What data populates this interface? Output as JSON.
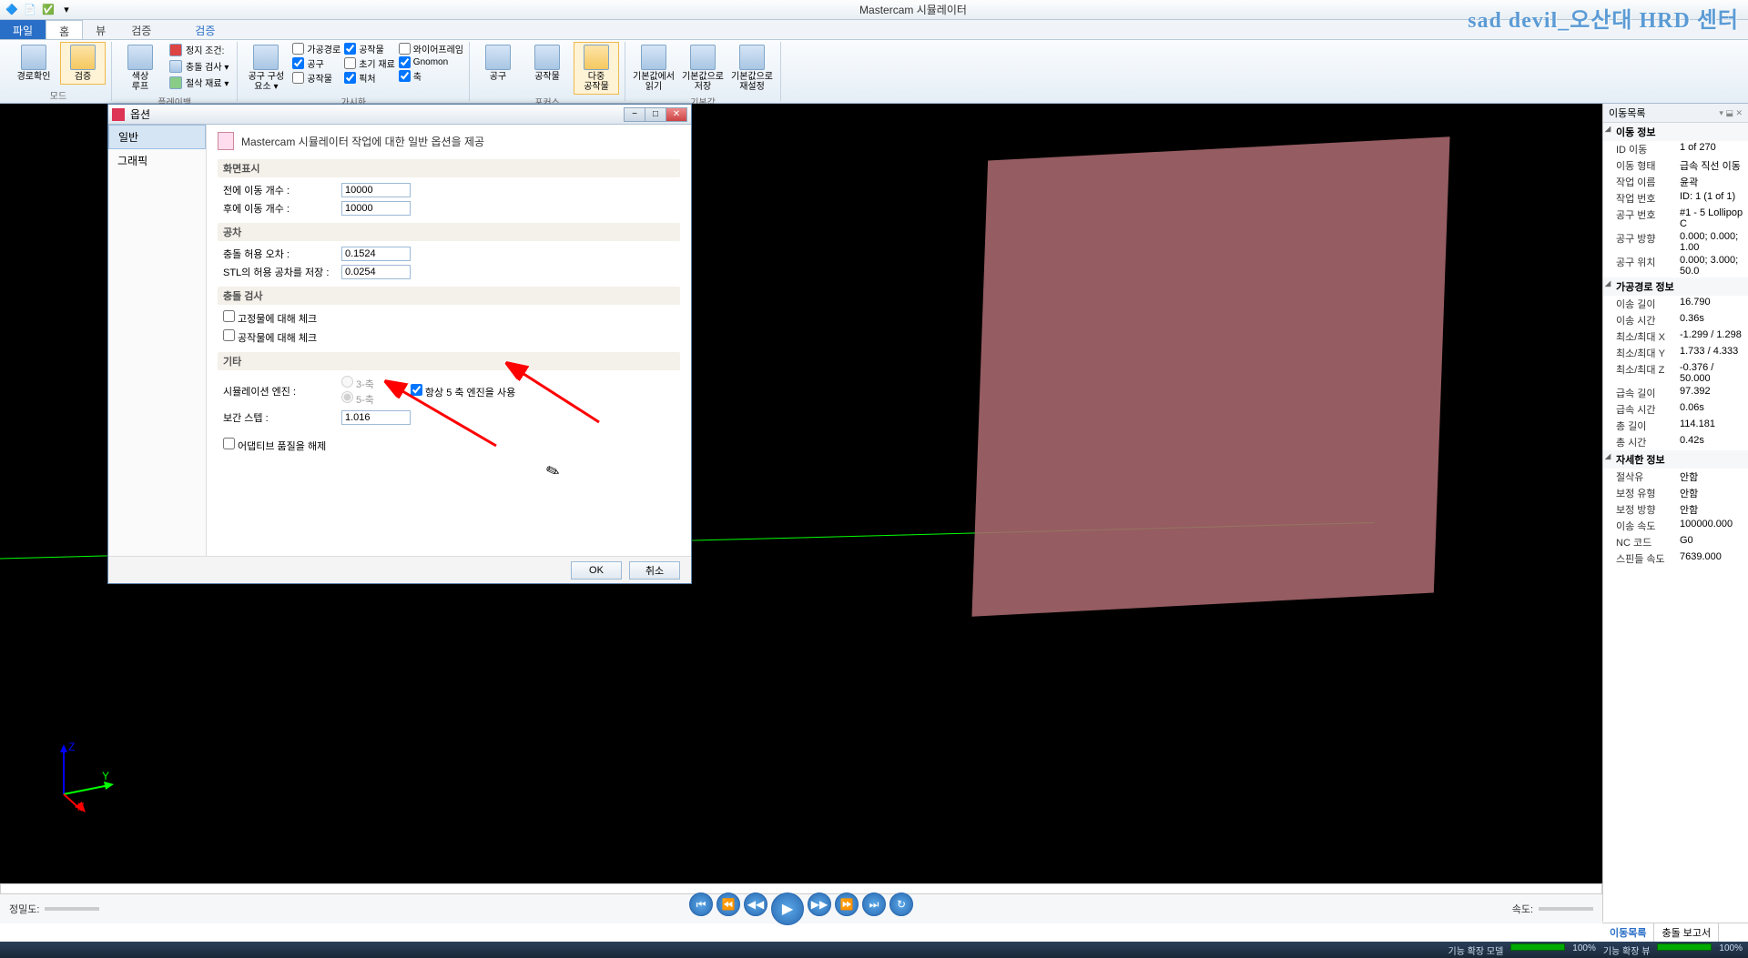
{
  "title": "Mastercam 시뮬레이터",
  "watermark": "sad devil_오산대 HRD 센터",
  "ribbon": {
    "context_tab": "검증",
    "tabs": {
      "file": "파일",
      "home": "홈",
      "view": "뷰",
      "verify": "검증"
    },
    "mode": {
      "path_check": "경로확인",
      "verify": "검증",
      "group": "모드"
    },
    "playback": {
      "color_loop": "색상\n루프",
      "stop_cond": "정지 조건:",
      "collision_check": "충돌 검사 ▾",
      "trace_stock": "절삭 재료 ▾",
      "group": "플레이백"
    },
    "visibility": {
      "tool_comp": "공구 구성\n요소 ▾",
      "col1": [
        "가공경로",
        "공구",
        "공작물"
      ],
      "col2": [
        "공작물",
        "초기 재료",
        "픽처"
      ],
      "col3": [
        "와이어프레임",
        "Gnomon",
        "축"
      ],
      "group": "가시화"
    },
    "focus": {
      "tool": "공구",
      "workpiece": "공작물",
      "multi": "다중\n공작물",
      "group": "포커스"
    },
    "defaults": {
      "read": "기본값에서\n읽기",
      "save": "기본값으로\n저장",
      "reset": "기본값으로\n재설정",
      "group": "기본값"
    }
  },
  "dialog": {
    "title": "옵션",
    "nav": {
      "general": "일반",
      "graphic": "그래픽"
    },
    "heading": "Mastercam 시뮬레이터 작업에 대한 일반 옵션을 제공",
    "sec_display": "화면표시",
    "before_moves": "전에 이동 개수 :",
    "before_moves_val": "10000",
    "after_moves": "후에 이동 개수 :",
    "after_moves_val": "10000",
    "sec_tolerance": "공차",
    "col_tol": "충돌 허용 오차 :",
    "col_tol_val": "0.1524",
    "stl_tol": "STL의 허용 공차를 저장 :",
    "stl_tol_val": "0.0254",
    "sec_collision": "충돌 검사",
    "chk_fixture": "고정물에 대해 체크",
    "chk_workpiece": "공작물에 대해 체크",
    "sec_other": "기타",
    "sim_engine": "시뮬레이션 엔진 :",
    "radio_3": "3-축",
    "radio_5": "5-축",
    "always_5": "항상 5 축 엔진을 사용",
    "interp_step": "보간 스텝 :",
    "interp_step_val": "1.016",
    "adaptive": "어댑티브 품질을 해제",
    "ok": "OK",
    "cancel": "취소"
  },
  "axis": {
    "x": "X",
    "y": "Y",
    "z": "Z"
  },
  "right_panel": {
    "title": "이동목록",
    "sec1": "이동 정보",
    "rows1": [
      [
        "ID 이동",
        "1 of 270"
      ],
      [
        "이동 형태",
        "급속 직선 이동"
      ],
      [
        "작업 이름",
        "윤곽"
      ],
      [
        "작업 번호",
        "ID: 1 (1 of 1)"
      ],
      [
        "공구 번호",
        "#1 - 5 Lollipop C"
      ],
      [
        "공구 방향",
        "0.000; 0.000; 1.00"
      ],
      [
        "공구 위치",
        "0.000; 3.000; 50.0"
      ]
    ],
    "sec2": "가공경로 정보",
    "rows2": [
      [
        "이송 길이",
        "16.790"
      ],
      [
        "이송 시간",
        "0.36s"
      ],
      [
        "최소/최대 X",
        "-1.299 / 1.298"
      ],
      [
        "최소/최대 Y",
        "1.733 / 4.333"
      ],
      [
        "최소/최대 Z",
        "-0.376 / 50.000"
      ],
      [
        "급속 길이",
        "97.392"
      ],
      [
        "급속 시간",
        "0.06s"
      ],
      [
        "총 길이",
        "114.181"
      ],
      [
        "총 시간",
        "0.42s"
      ]
    ],
    "sec3": "자세한 정보",
    "rows3": [
      [
        "절삭유",
        "안함"
      ],
      [
        "보정 유형",
        "안함"
      ],
      [
        "보정 방향",
        "안함"
      ],
      [
        "이송 속도",
        "100000.000"
      ],
      [
        "NC 코드",
        "G0"
      ],
      [
        "스핀들 속도",
        "7639.000"
      ]
    ],
    "tabs": {
      "moves": "이동목록",
      "report": "충돌 보고서"
    }
  },
  "playback": {
    "precision": "정밀도:",
    "speed": "속도:"
  },
  "status": {
    "model": "기능 확장 모델",
    "view": "기능 확장 뷰",
    "pct": "100%"
  }
}
